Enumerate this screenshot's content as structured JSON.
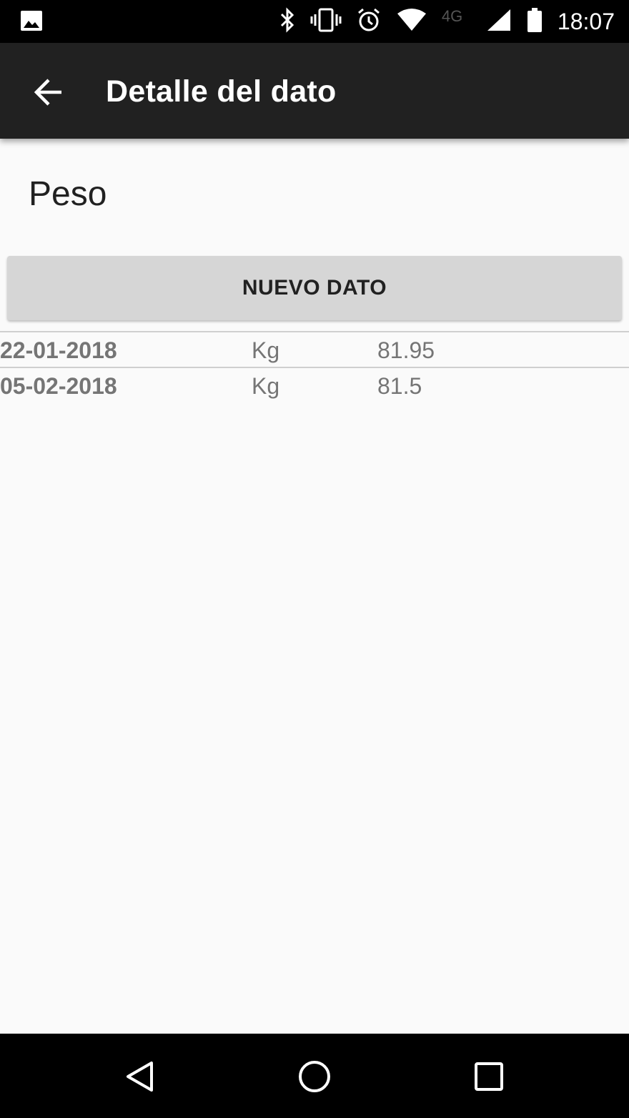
{
  "status_bar": {
    "time": "18:07",
    "network": "4G",
    "icons": [
      "image-icon",
      "bluetooth-icon",
      "vibrate-icon",
      "alarm-icon",
      "wifi-icon",
      "signal-icon",
      "battery-icon"
    ]
  },
  "app_bar": {
    "title": "Detalle del dato",
    "back_icon": "arrow-back-icon"
  },
  "section": {
    "title": "Peso"
  },
  "new_button": {
    "label": "NUEVO DATO"
  },
  "entries": [
    {
      "date": "22-01-2018",
      "unit": "Kg",
      "value": "81.95"
    },
    {
      "date": "05-02-2018",
      "unit": "Kg",
      "value": "81.5"
    }
  ],
  "nav_bar": {
    "icons": [
      "back-triangle-icon",
      "home-circle-icon",
      "recents-square-icon"
    ]
  },
  "colors": {
    "app_bar": "#212121",
    "background": "#fafafa",
    "button": "#d6d6d6",
    "text_secondary": "#757575"
  }
}
